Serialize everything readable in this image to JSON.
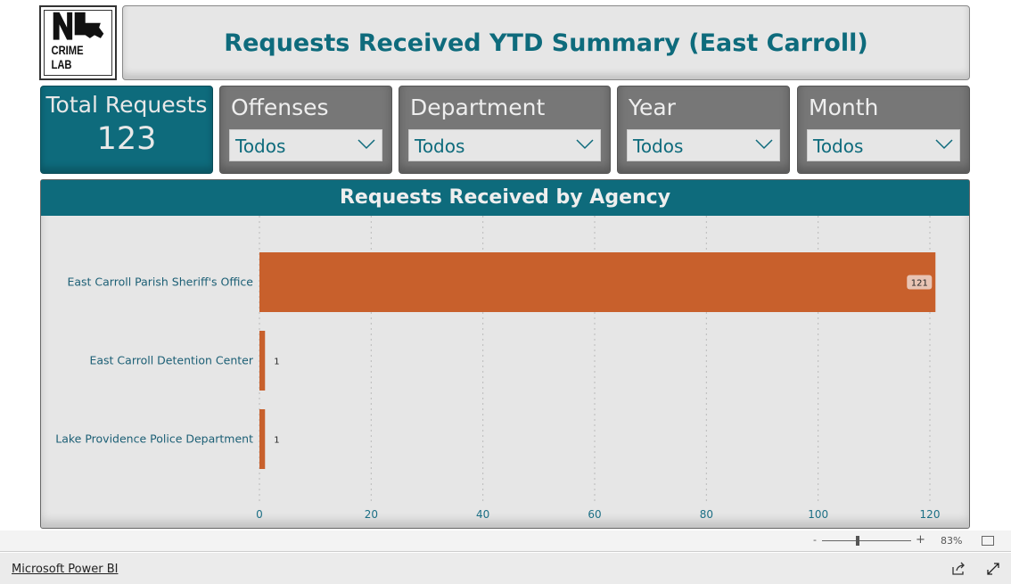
{
  "logo": {
    "text": "NL CRIME LAB"
  },
  "header": {
    "title": "Requests Received YTD Summary (East Carroll)"
  },
  "kpi": {
    "label": "Total Requests",
    "value": "123"
  },
  "slicers": [
    {
      "label": "Offenses",
      "value": "Todos"
    },
    {
      "label": "Department",
      "value": "Todos"
    },
    {
      "label": "Year",
      "value": "Todos"
    },
    {
      "label": "Month",
      "value": "Todos"
    }
  ],
  "chart_data": {
    "type": "bar",
    "orientation": "horizontal",
    "title": "Requests Received by Agency",
    "categories": [
      "East Carroll Parish Sheriff's Office",
      "East Carroll Detention Center",
      "Lake Providence Police Department"
    ],
    "values": [
      121,
      1,
      1
    ],
    "data_labels": [
      "121",
      "1",
      "1"
    ],
    "xlim": [
      0,
      120
    ],
    "xticks": [
      "0",
      "20",
      "40",
      "60",
      "80",
      "100",
      "120"
    ],
    "grid": true,
    "bar_color": "#c8602c"
  },
  "footer": {
    "zoom_minus": "-",
    "zoom_plus": "+",
    "zoom": "83%",
    "brand_link": "Microsoft Power BI"
  },
  "colors": {
    "teal": "#0e6b7c",
    "bar": "#c8602c"
  }
}
